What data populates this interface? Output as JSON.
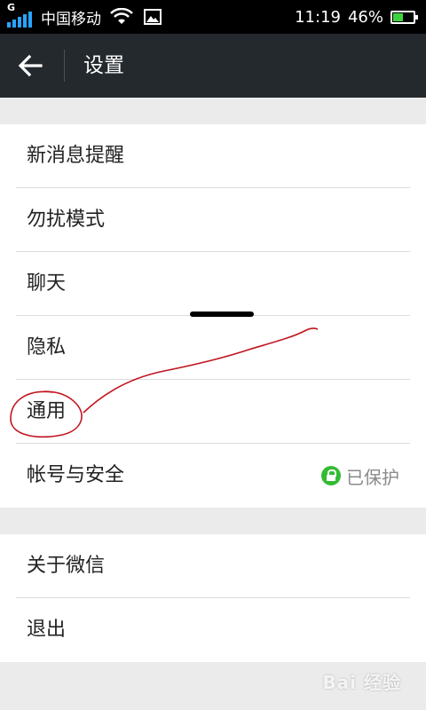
{
  "status_bar": {
    "network_type": "G",
    "carrier": "中国移动",
    "time": "11:19",
    "battery_percent": "46%",
    "battery_level": 0.46,
    "battery_color": "#3fd43f",
    "icons": [
      "signal-icon",
      "wifi-icon",
      "image-notification-icon",
      "battery-icon"
    ]
  },
  "titlebar": {
    "title": "设置",
    "back_icon": "arrow-left-icon"
  },
  "settings": {
    "group1": [
      {
        "label": "新消息提醒"
      },
      {
        "label": "勿扰模式"
      },
      {
        "label": "聊天"
      },
      {
        "label": "隐私"
      },
      {
        "label": "通用"
      },
      {
        "label": "帐号与安全",
        "status": "已保护",
        "status_icon": "lock-icon"
      }
    ],
    "group2": [
      {
        "label": "关于微信"
      },
      {
        "label": "退出"
      }
    ]
  },
  "watermark": {
    "text": "Bai 经验"
  },
  "colors": {
    "titlebar_bg": "#23292d",
    "accent_green": "#33bb33",
    "annotation_red": "#c0141e"
  }
}
